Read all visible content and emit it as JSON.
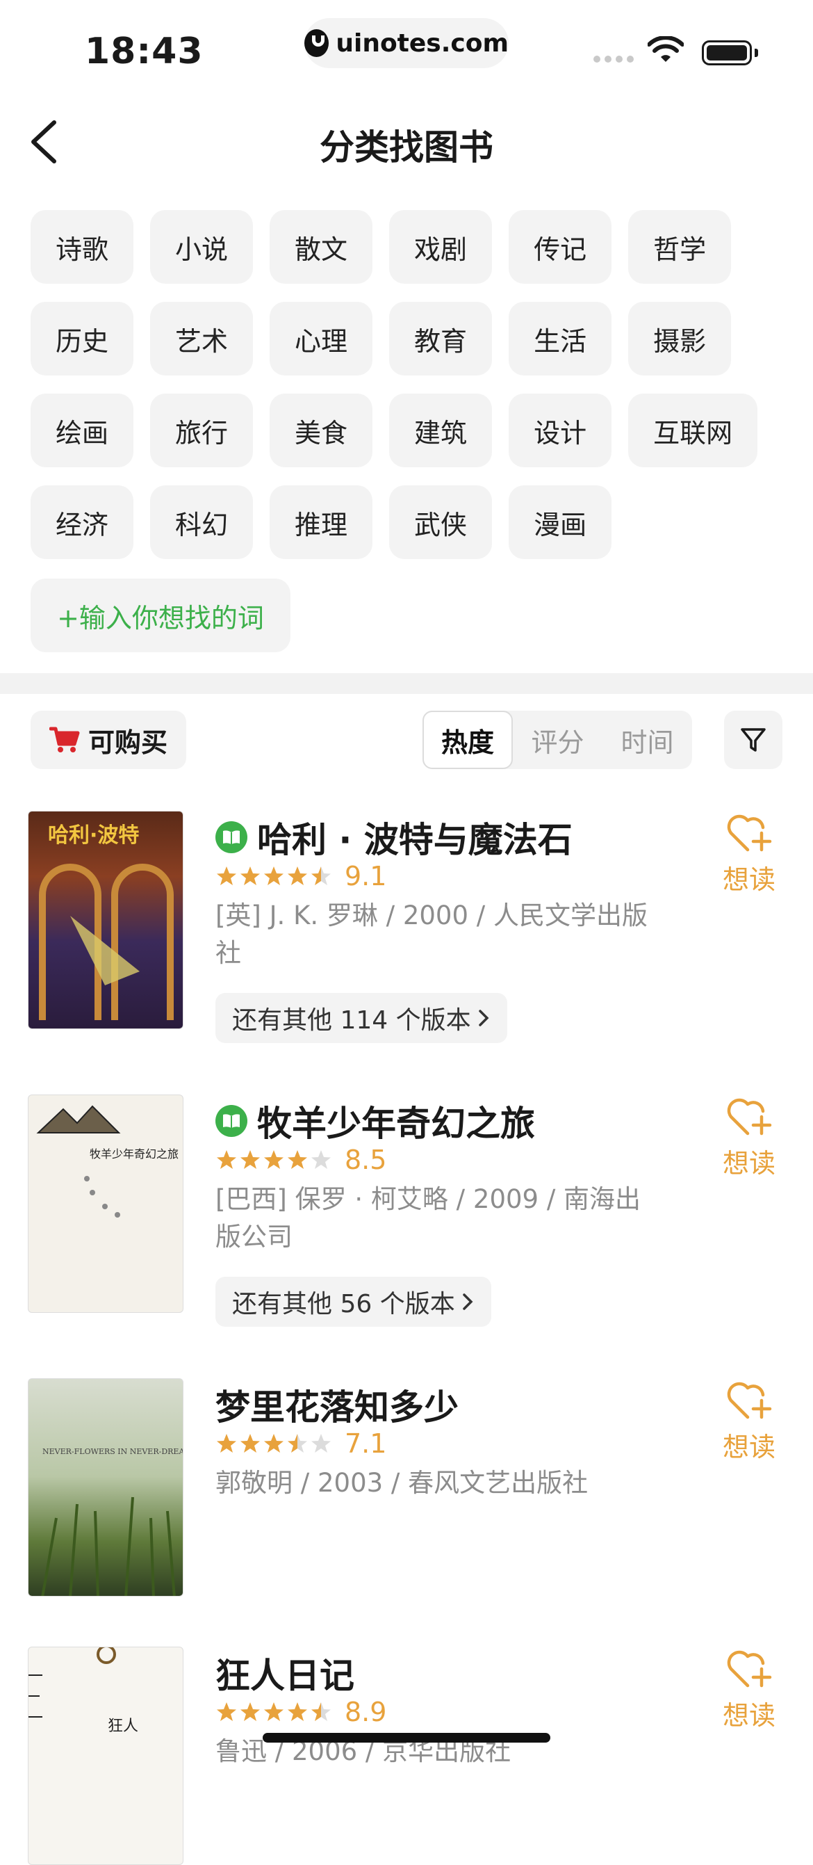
{
  "status_bar": {
    "time": "18:43",
    "url": "uinotes.com"
  },
  "header": {
    "title": "分类找图书"
  },
  "tags": [
    "诗歌",
    "小说",
    "散文",
    "戏剧",
    "传记",
    "哲学",
    "历史",
    "艺术",
    "心理",
    "教育",
    "生活",
    "摄影",
    "绘画",
    "旅行",
    "美食",
    "建筑",
    "设计",
    "互联网",
    "经济",
    "科幻",
    "推理",
    "武侠",
    "漫画"
  ],
  "add_tag_label": "+输入你想找的词",
  "filters": {
    "buy_label": "可购买",
    "sort_options": [
      "热度",
      "评分",
      "时间"
    ],
    "active_sort": "热度"
  },
  "books": [
    {
      "title": "哈利 · 波特与魔法石",
      "has_ebook": true,
      "stars": 4.5,
      "score": "9.1",
      "meta": "[英] J. K. 罗琳 / 2000 / 人民文学出版社",
      "editions": "还有其他 114 个版本",
      "want_label": "想读",
      "cover_text": "哈利·波特"
    },
    {
      "title": "牧羊少年奇幻之旅",
      "has_ebook": true,
      "stars": 4,
      "score": "8.5",
      "meta": "[巴西] 保罗 · 柯艾略 / 2009 / 南海出版公司",
      "editions": "还有其他 56 个版本",
      "want_label": "想读",
      "cover_text": "牧羊少年奇幻之旅"
    },
    {
      "title": "梦里花落知多少",
      "has_ebook": false,
      "stars": 3.5,
      "score": "7.1",
      "meta": "郭敬明 / 2003 / 春风文艺出版社",
      "editions": "",
      "want_label": "想读",
      "cover_text": "NEVER-FLOWERS IN NEVER-DREAM"
    },
    {
      "title": "狂人日记",
      "has_ebook": false,
      "stars": 4.5,
      "score": "8.9",
      "meta": "鲁迅 / 2006 / 京华出版社",
      "editions": "",
      "want_label": "想读",
      "cover_text": "狂人"
    }
  ],
  "colors": {
    "accent_green": "#3cb04a",
    "accent_orange": "#e8a23c",
    "buy_red": "#d9262c"
  }
}
